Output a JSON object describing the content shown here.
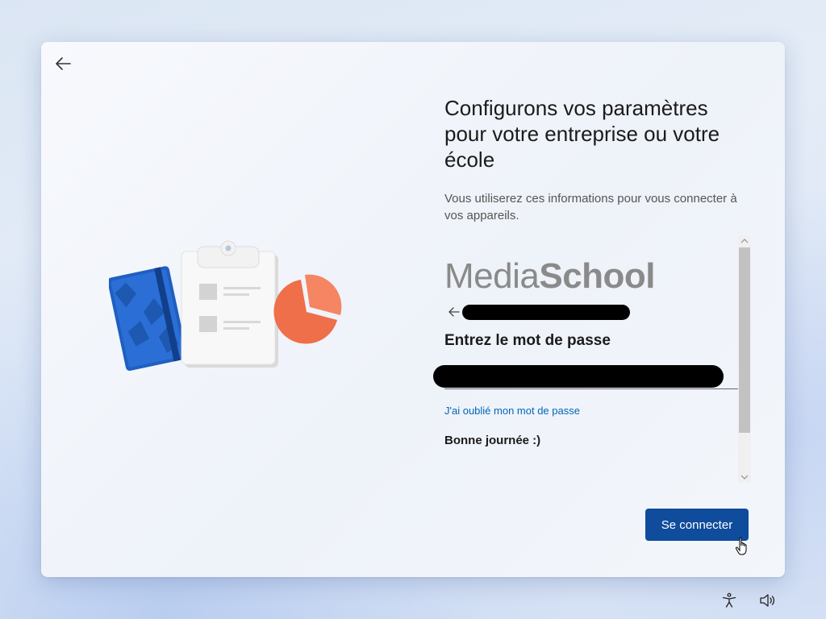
{
  "window": {
    "title": "Configurons vos paramètres pour votre entreprise ou votre école",
    "subtitle": "Vous utiliserez ces informations pour vous connecter à vos appareils."
  },
  "signin": {
    "logo_part1": "Media",
    "logo_part2": "School",
    "password_heading": "Entrez le mot de passe",
    "forgot_link": "J'ai oublié mon mot de passe",
    "greeting": "Bonne journée :)"
  },
  "actions": {
    "connect_label": "Se connecter"
  },
  "icons": {
    "back": "back-arrow-icon",
    "identity_back": "back-arrow-icon",
    "accessibility": "accessibility-icon",
    "volume": "volume-icon"
  },
  "colors": {
    "primary_button": "#0f4c9c",
    "link": "#0067b8",
    "notebook": "#1f5fc2",
    "pie": "#ef6f4a"
  }
}
